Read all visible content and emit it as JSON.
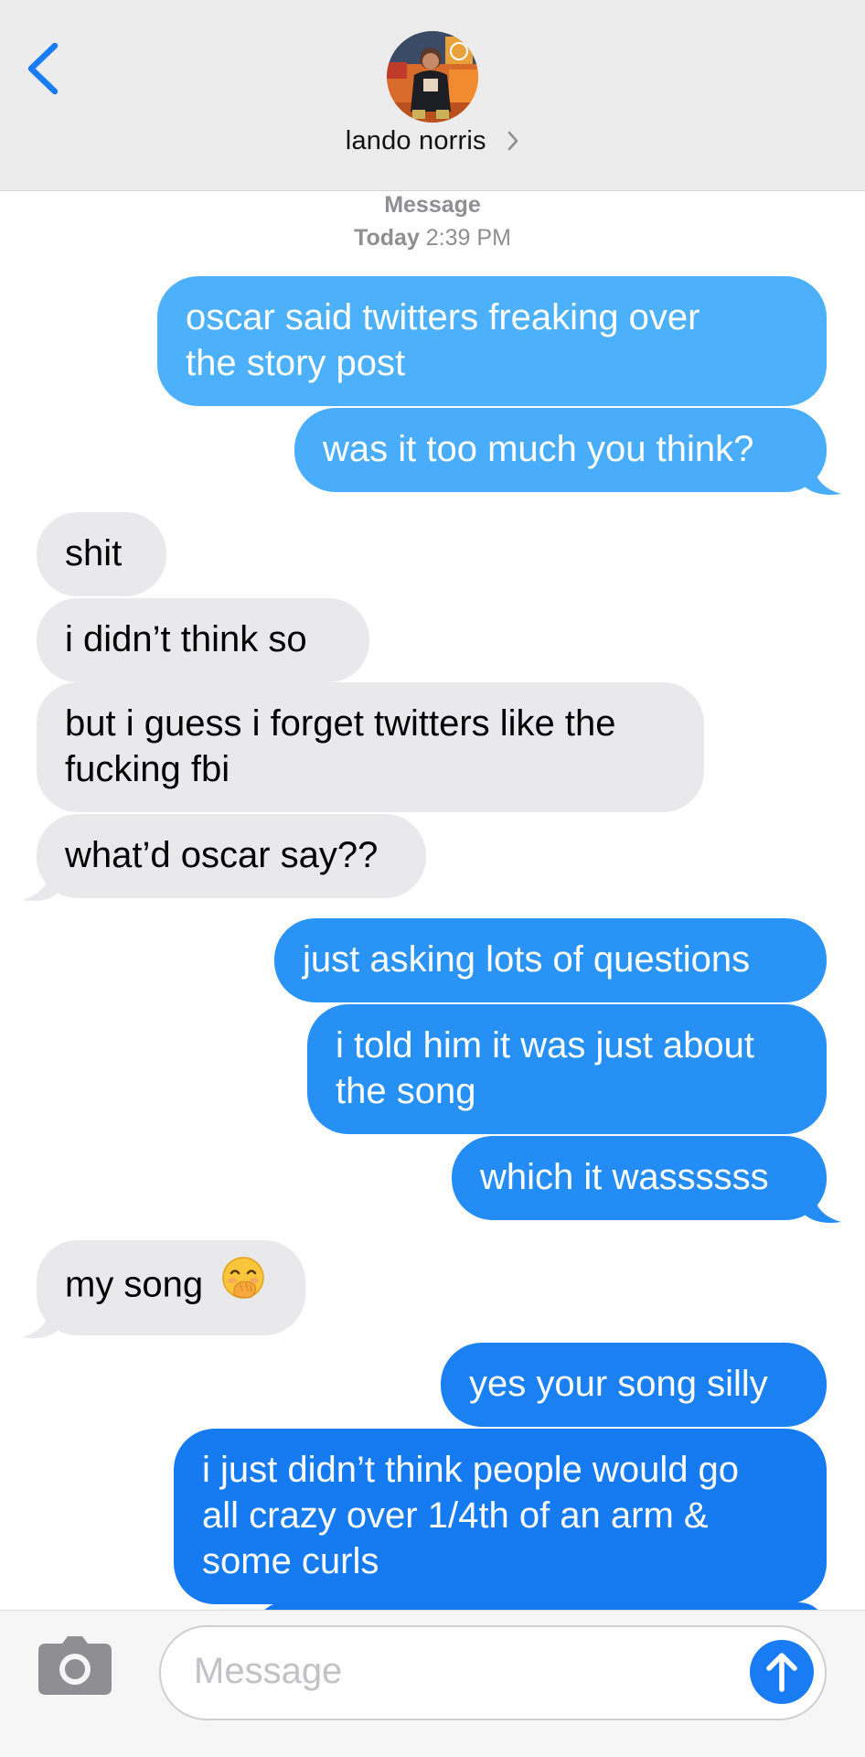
{
  "header": {
    "contact_name": "lando norris",
    "back_icon": "chevron-left-icon",
    "chevron_icon": "chevron-right-icon",
    "accent_color": "#1a7cf5"
  },
  "thread": {
    "service_label": "Message",
    "timestamp_day": "Today",
    "timestamp_time": "2:39 PM"
  },
  "messages": [
    {
      "sender": "me",
      "lines": [
        "oscar said twitters freaking over",
        "the story post"
      ]
    },
    {
      "sender": "me",
      "lines": [
        "was it too much you think?"
      ],
      "tail": true
    },
    {
      "sender": "them",
      "lines": [
        "shit"
      ]
    },
    {
      "sender": "them",
      "lines": [
        "i didn’t think so"
      ]
    },
    {
      "sender": "them",
      "lines": [
        "but i guess i forget twitters like the",
        "fucking fbi"
      ]
    },
    {
      "sender": "them",
      "lines": [
        "what’d oscar say??"
      ],
      "tail": true
    },
    {
      "sender": "me",
      "lines": [
        "just asking lots of questions"
      ]
    },
    {
      "sender": "me",
      "lines": [
        "i told him it was just about",
        "the song"
      ]
    },
    {
      "sender": "me",
      "lines": [
        "which it wassssss"
      ],
      "tail": true
    },
    {
      "sender": "them",
      "lines": [
        "my song"
      ],
      "emoji": "face-with-hand-over-mouth",
      "tail": true
    },
    {
      "sender": "me",
      "lines": [
        "yes your song silly"
      ]
    },
    {
      "sender": "me",
      "lines": [
        "i just didn’t think people would go",
        "all crazy over 1/4th of an arm &",
        "some curls"
      ]
    }
  ],
  "colors": {
    "sent_top": "#4fb0fb",
    "sent_bottom": "#1479f1",
    "received": "#e9e9eb",
    "timestamp": "#8e8e93"
  },
  "composer": {
    "placeholder": "Message",
    "camera_icon": "camera-icon",
    "send_icon": "arrow-up-icon"
  }
}
